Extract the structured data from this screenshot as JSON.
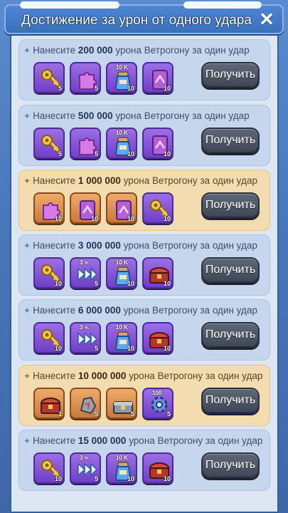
{
  "header": {
    "title": "Достижение за урон от одного удара",
    "close_label": "✕"
  },
  "rows": [
    {
      "prefix": "Нанесите ",
      "amount": "200 000",
      "suffix": " урона Ветрогону за один удар",
      "style": "blue",
      "button": "Получить",
      "items": [
        {
          "icon": "golden-key-icon",
          "qty": "5",
          "color": "purple",
          "tag": ""
        },
        {
          "icon": "puzzle-piece-icon",
          "qty": "5",
          "color": "purple",
          "tag": ""
        },
        {
          "icon": "exp-potion-icon",
          "qty": "10",
          "color": "purple",
          "tag": "10 K"
        },
        {
          "icon": "skill-book-icon",
          "qty": "10",
          "color": "purple",
          "tag": ""
        }
      ]
    },
    {
      "prefix": "Нанесите ",
      "amount": "500 000",
      "suffix": " урона Ветрогону за один удар",
      "style": "blue",
      "button": "Получить",
      "items": [
        {
          "icon": "golden-key-icon",
          "qty": "5",
          "color": "purple",
          "tag": ""
        },
        {
          "icon": "puzzle-piece-icon",
          "qty": "5",
          "color": "purple",
          "tag": ""
        },
        {
          "icon": "exp-potion-icon",
          "qty": "10",
          "color": "purple",
          "tag": "10 K"
        },
        {
          "icon": "skill-book-icon",
          "qty": "10",
          "color": "purple",
          "tag": ""
        }
      ]
    },
    {
      "prefix": "Нанесите ",
      "amount": "1 000 000",
      "suffix": " урона Ветрогону за один удар",
      "style": "gold",
      "button": "Получить",
      "items": [
        {
          "icon": "puzzle-piece-icon",
          "qty": "10",
          "color": "orange",
          "tag": ""
        },
        {
          "icon": "skill-book-icon",
          "qty": "10",
          "color": "orange",
          "tag": ""
        },
        {
          "icon": "skill-book-icon",
          "qty": "10",
          "color": "orange",
          "tag": ""
        },
        {
          "icon": "golden-key-icon",
          "qty": "10",
          "color": "purple",
          "tag": ""
        }
      ]
    },
    {
      "prefix": "Нанесите ",
      "amount": "3 000 000",
      "suffix": " урона Ветрогону за один удар",
      "style": "blue",
      "button": "Получить",
      "items": [
        {
          "icon": "golden-key-icon",
          "qty": "10",
          "color": "purple",
          "tag": ""
        },
        {
          "icon": "speed-up-icon",
          "qty": "5",
          "color": "purple",
          "tag": "3 ч."
        },
        {
          "icon": "exp-potion-icon",
          "qty": "10",
          "color": "purple",
          "tag": "10 K"
        },
        {
          "icon": "treasure-chest-icon",
          "qty": "10",
          "color": "purple",
          "tag": ""
        }
      ]
    },
    {
      "prefix": "Нанесите ",
      "amount": "6 000 000",
      "suffix": " урона Ветрогону за один удар",
      "style": "blue",
      "button": "Получить",
      "items": [
        {
          "icon": "golden-key-icon",
          "qty": "10",
          "color": "purple",
          "tag": ""
        },
        {
          "icon": "speed-up-icon",
          "qty": "5",
          "color": "purple",
          "tag": "3 ч."
        },
        {
          "icon": "exp-potion-icon",
          "qty": "10",
          "color": "purple",
          "tag": "10 K"
        },
        {
          "icon": "treasure-chest-icon",
          "qty": "10",
          "color": "purple",
          "tag": ""
        }
      ]
    },
    {
      "prefix": "Нанесите ",
      "amount": "10 000 000",
      "suffix": " урона Ветрогону за один удар",
      "style": "gold",
      "button": "Получить",
      "items": [
        {
          "icon": "treasure-chest-icon",
          "qty": "1",
          "color": "orange",
          "tag": ""
        },
        {
          "icon": "ore-stone-icon",
          "qty": "5",
          "color": "orange",
          "tag": ""
        },
        {
          "icon": "iron-chest-icon",
          "qty": "5",
          "color": "orange",
          "tag": ""
        },
        {
          "icon": "gear-cog-icon",
          "qty": "5",
          "color": "purple",
          "tag": "100"
        }
      ]
    },
    {
      "prefix": "Нанесите ",
      "amount": "15 000 000",
      "suffix": " урона Ветрогону за один удар",
      "style": "blue",
      "button": "Получить",
      "items": [
        {
          "icon": "golden-key-icon",
          "qty": "10",
          "color": "purple",
          "tag": ""
        },
        {
          "icon": "speed-up-icon",
          "qty": "5",
          "color": "purple",
          "tag": "3 ч."
        },
        {
          "icon": "exp-potion-icon",
          "qty": "10",
          "color": "purple",
          "tag": "10 K"
        },
        {
          "icon": "treasure-chest-icon",
          "qty": "10",
          "color": "purple",
          "tag": ""
        }
      ]
    }
  ]
}
